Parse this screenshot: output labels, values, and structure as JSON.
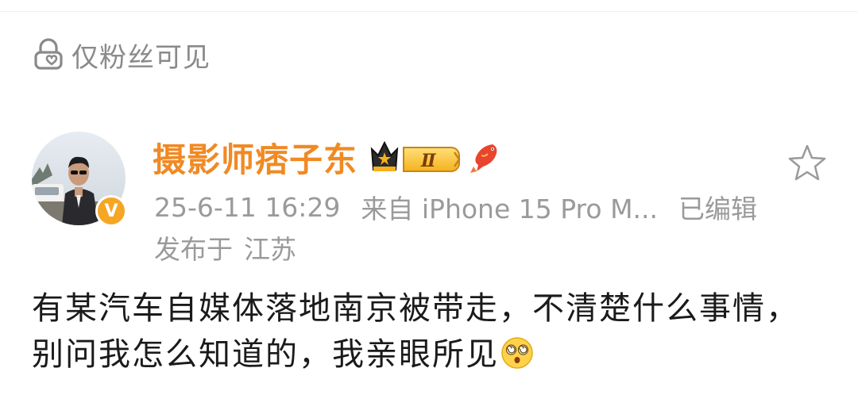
{
  "visibility": {
    "icon": "lock-heart-icon",
    "label": "仅粉丝可见"
  },
  "author": {
    "name": "摄影师痞子东",
    "avatar": "avatar",
    "verified_badge": "V",
    "member_badge": "Ⅱ",
    "member_badge_icon": "crown-badge-icon",
    "fish_icon": "koi-fish-icon"
  },
  "meta": {
    "timestamp": "25-6-11 16:29",
    "source": "来自 iPhone 15 Pro M...",
    "edited": "已编辑",
    "location_prefix": "发布于",
    "location": "江苏"
  },
  "actions": {
    "favorite_icon": "star-icon"
  },
  "post": {
    "text": "有某汽车自媒体落地南京被带走，不清楚什么事情，别问我怎么知道的，我亲眼所见",
    "trailing_emoji": "dizzy-eyes-emoji-icon"
  },
  "colors": {
    "username": "#f08a24",
    "meta_text": "#9a9a9a",
    "body_text": "#1a1a1a",
    "verified": "#f5a623"
  }
}
